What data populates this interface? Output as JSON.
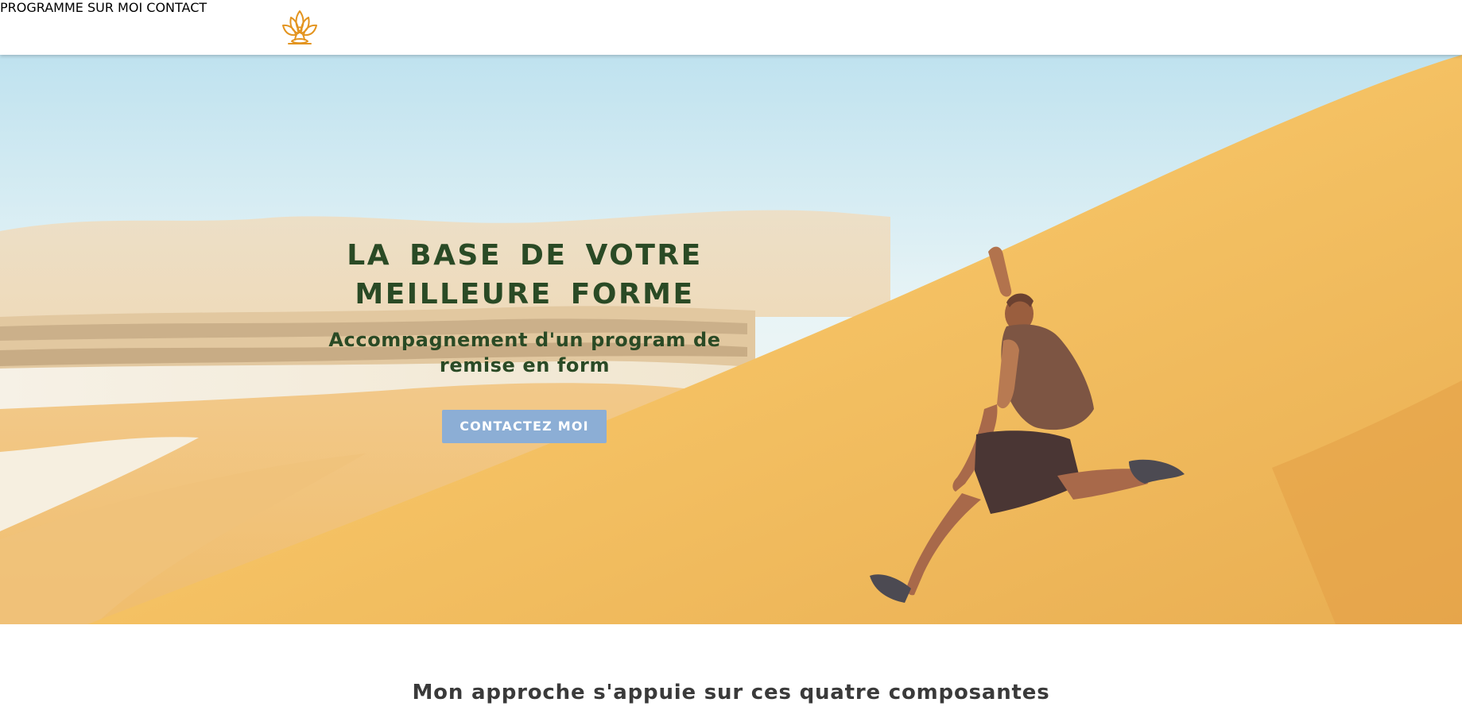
{
  "header": {
    "logo_icon": "lotus-meditation-icon",
    "logo_color": "#e3941f",
    "nav": [
      {
        "label": "PROGRAMME"
      },
      {
        "label": "SUR MOI"
      },
      {
        "label": "CONTACT"
      }
    ]
  },
  "hero": {
    "background": "photo of a man leaping down a sand dune",
    "title": "LA BASE DE VOTRE MEILLEURE FORME",
    "subtitle": "Accompagnement d'un program de remise en form",
    "cta_label": "CONTACTEZ MOI",
    "text_color": "#2a4a25",
    "cta_color": "#8caed5"
  },
  "approach": {
    "heading": "Mon approche s'appuie sur ces quatre composantes"
  }
}
